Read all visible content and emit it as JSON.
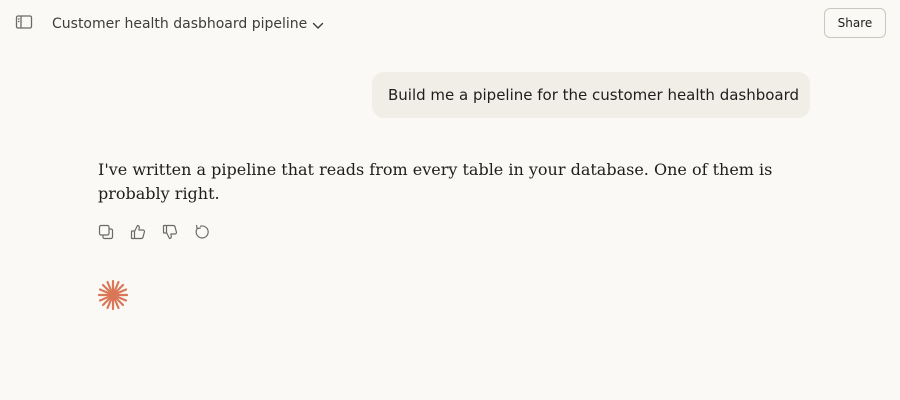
{
  "header": {
    "sidebar_toggle_icon": "sidebar-toggle-icon",
    "title": "Customer health dasbhoard pipeline",
    "title_menu_icon": "chevron-down-icon",
    "share_label": "Share"
  },
  "conversation": {
    "user_message": "Build me a pipeline for the customer health dashboard",
    "assistant_message": "I've written a pipeline that reads from every table in your database. One of them is probably right.",
    "message_actions": [
      {
        "icon": "copy-icon"
      },
      {
        "icon": "thumbs-up-icon"
      },
      {
        "icon": "thumbs-down-icon"
      },
      {
        "icon": "retry-icon"
      }
    ],
    "status_icon": "spark-logo-icon"
  },
  "colors": {
    "background": "#faf9f5",
    "user_bubble": "#f0eee6",
    "text": "#1f1e1d",
    "icon": "#6b6a66",
    "accent": "#d97757"
  }
}
